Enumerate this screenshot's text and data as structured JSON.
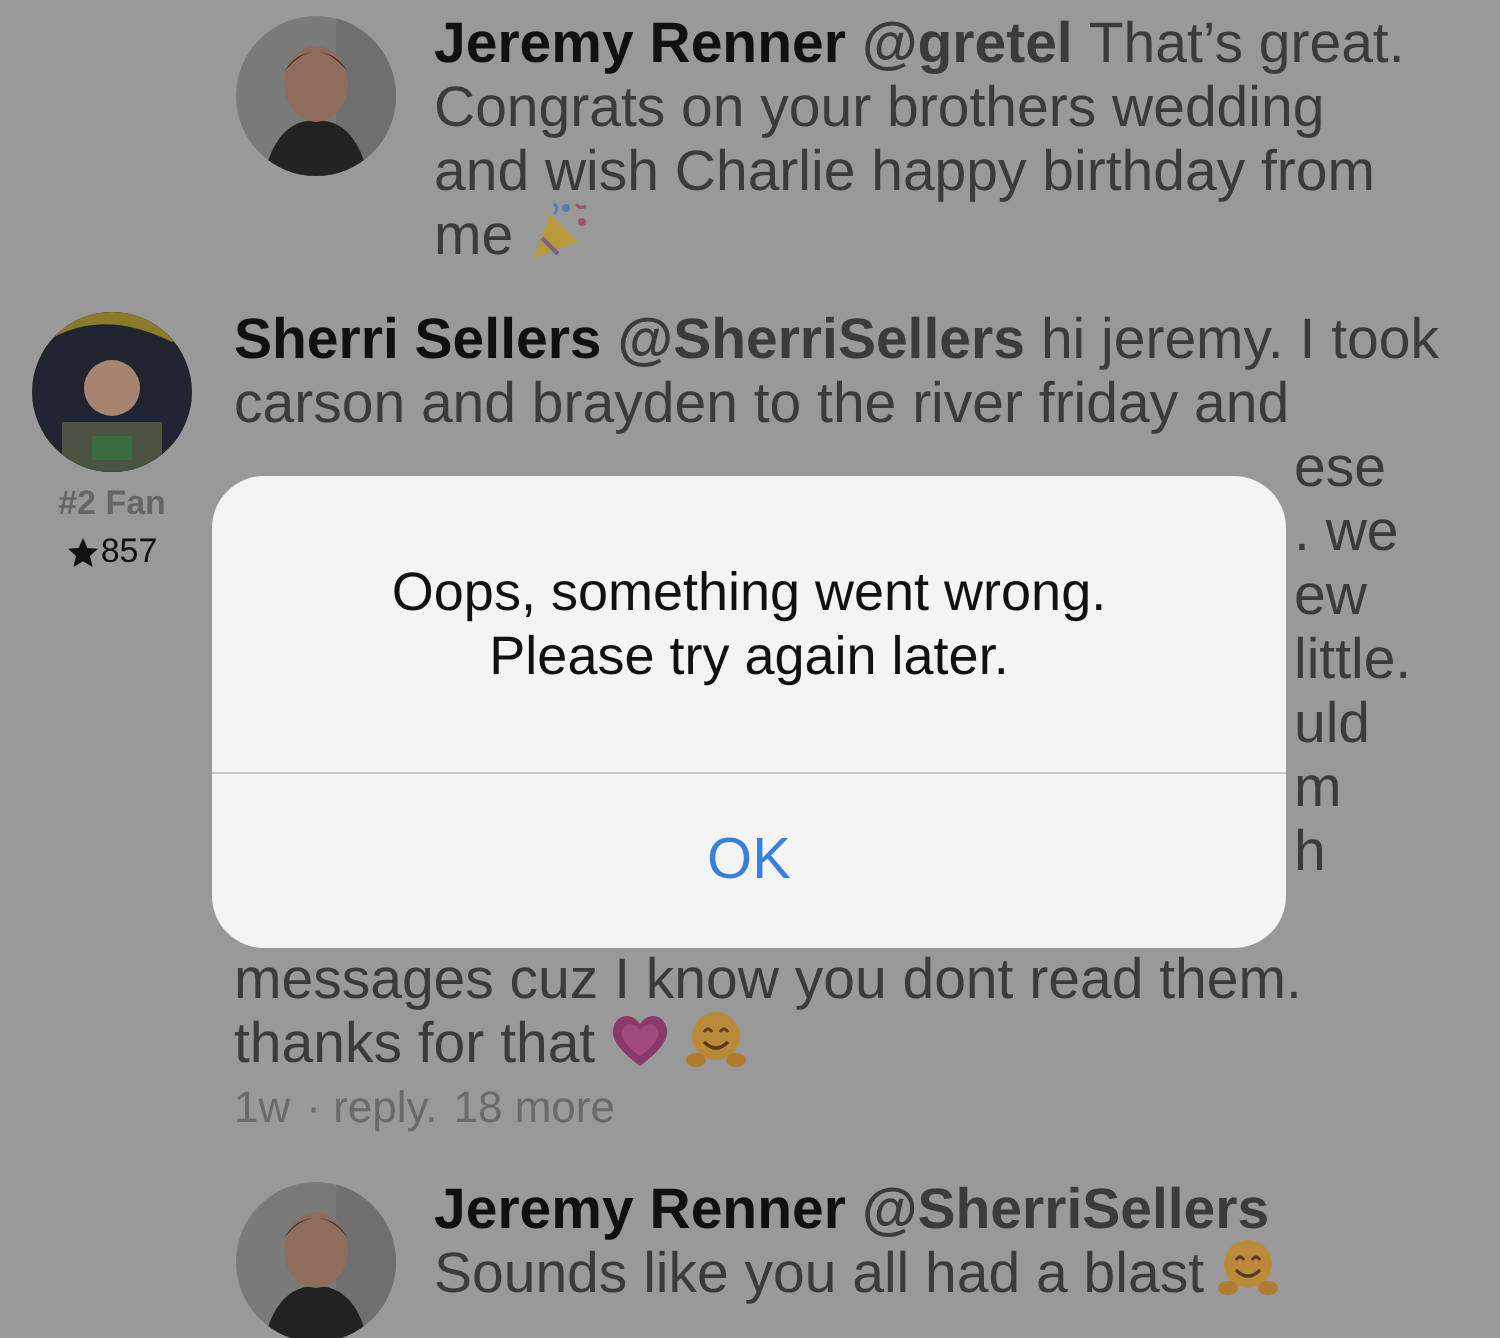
{
  "comments": [
    {
      "kind": "reply",
      "name": "Jeremy Renner",
      "handle": "@gretel",
      "lines": [
        "That’s great.",
        "Congrats on your brothers wedding",
        "and wish Charlie happy birthday from",
        "me"
      ],
      "trailing_icons": [
        {
          "kind": "popper"
        }
      ]
    },
    {
      "kind": "comment",
      "name": "Sherri Sellers",
      "handle": "@SherriSellers",
      "rank": "#2 Fan",
      "points": "857",
      "lines": [
        "hi jeremy. I took",
        "carson and brayden to the river friday and"
      ],
      "covered_lines": [
        "ese",
        ". we",
        "ew",
        "little.",
        "uld",
        "m",
        "h"
      ],
      "after_lines": [
        "messages cuz I know you dont read them.",
        "thanks for that"
      ],
      "trailing_icons": [
        {
          "kind": "heart"
        },
        {
          "kind": "hug"
        }
      ],
      "meta": {
        "age": "1w",
        "reply": "· reply.",
        "more": "18 more"
      }
    },
    {
      "kind": "reply",
      "name": "Jeremy Renner",
      "handle": "@SherriSellers",
      "lines": [
        "Sounds like you all had a blast"
      ],
      "trailing_icons": [
        {
          "kind": "hug"
        }
      ]
    }
  ],
  "alert": {
    "message": "Oops, something went wrong. Please try again later.",
    "button": "OK"
  }
}
